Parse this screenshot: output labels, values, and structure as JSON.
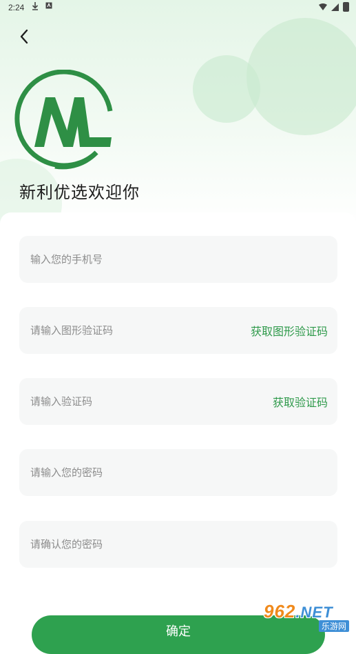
{
  "status_bar": {
    "time": "2:24"
  },
  "header": {
    "back_icon": "chevron-left-icon",
    "welcome_text": "新利优选欢迎你"
  },
  "form": {
    "phone": {
      "placeholder": "输入您的手机号",
      "value": ""
    },
    "image_captcha": {
      "placeholder": "请输入图形验证码",
      "value": "",
      "action": "获取图形验证码"
    },
    "sms_code": {
      "placeholder": "请输入验证码",
      "value": "",
      "action": "获取验证码"
    },
    "password": {
      "placeholder": "请输入您的密码",
      "value": ""
    },
    "confirm_password": {
      "placeholder": "请确认您的密码",
      "value": ""
    },
    "submit_label": "确定"
  },
  "watermark": {
    "main": "962",
    "suffix": ".NET",
    "sub": "乐游网"
  },
  "colors": {
    "brand_green": "#2ea14f",
    "link_green": "#2f9a4b",
    "field_bg": "#f6f7f7"
  }
}
